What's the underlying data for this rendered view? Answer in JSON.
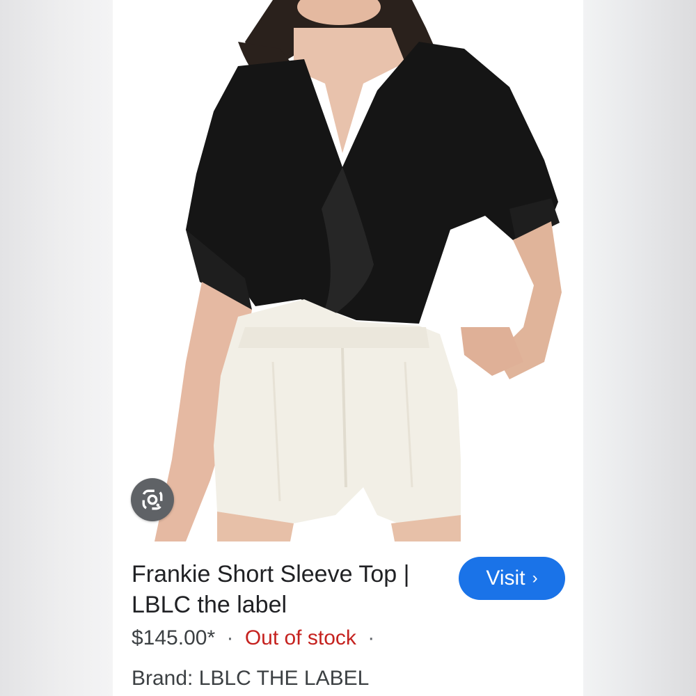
{
  "product": {
    "title_line1": "Frankie Short Sleeve Top |",
    "title_line2": "LBLC the label",
    "price": "$145.00*",
    "separator": "·",
    "stock_status": "Out of stock",
    "trailing_separator": "·",
    "brand_label": "Brand:",
    "brand_value": "LBLC THE LABEL"
  },
  "actions": {
    "visit_label": "Visit",
    "visit_chevron": "›"
  },
  "icons": {
    "lens": "google-lens-icon",
    "chevron": "chevron-right-icon"
  },
  "colors": {
    "accent": "#1a73e8",
    "stock_status": "#c5221f",
    "text": "#202124",
    "lens_button_bg": "#5f6266"
  }
}
